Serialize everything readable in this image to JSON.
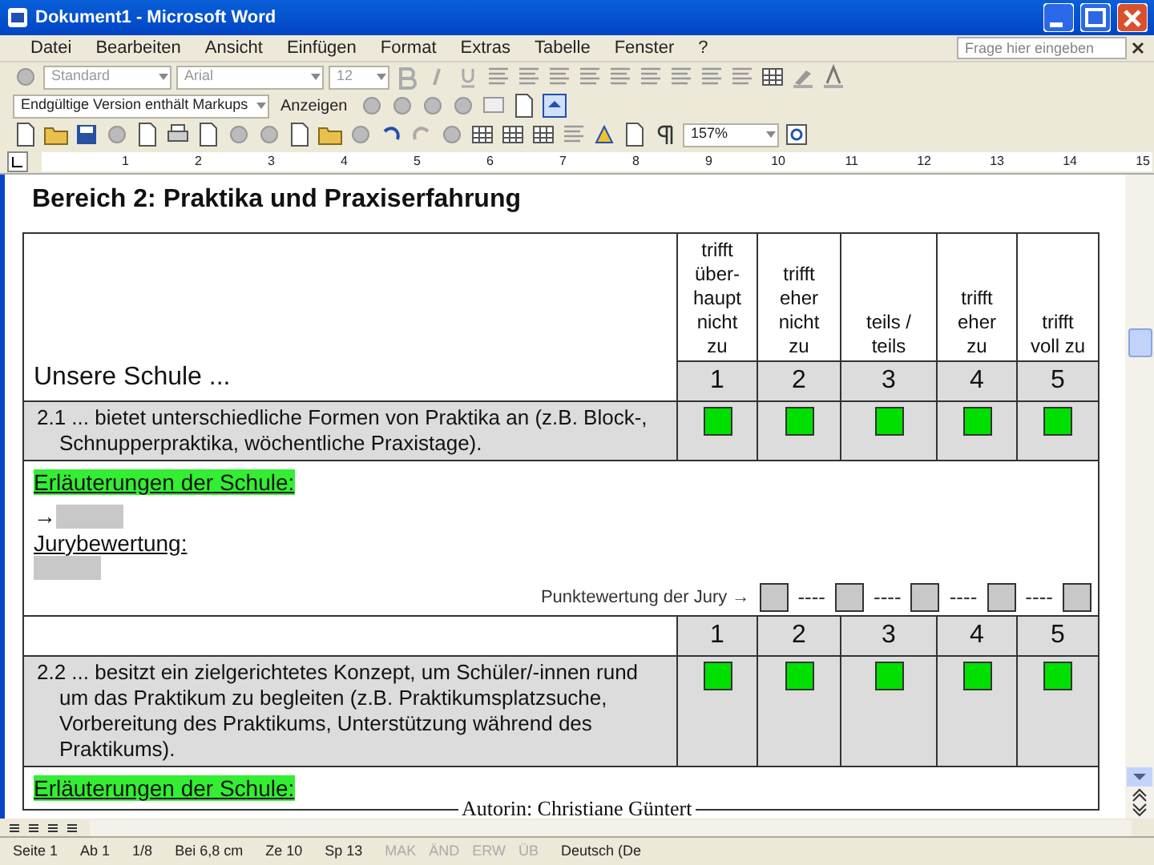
{
  "window": {
    "title": "Dokument1 - Microsoft Word"
  },
  "menu": [
    "Datei",
    "Bearbeiten",
    "Ansicht",
    "Einfügen",
    "Format",
    "Extras",
    "Tabelle",
    "Fenster",
    "?"
  ],
  "help_box": {
    "placeholder": "Frage hier eingeben"
  },
  "formatting": {
    "style": "Standard",
    "font": "Arial",
    "size": "12"
  },
  "reviewing": {
    "view": "Endgültige Version enthält Markups",
    "show": "Anzeigen"
  },
  "standard": {
    "zoom": "157%"
  },
  "ruler": [
    "1",
    "2",
    "3",
    "4",
    "5",
    "6",
    "7",
    "8",
    "9",
    "10",
    "11",
    "12",
    "13",
    "14",
    "15"
  ],
  "document": {
    "heading": "Bereich 2: Praktika und Praxiserfahrung",
    "table": {
      "intro": "Unsere Schule ...",
      "scale": [
        "trifft über-haupt nicht zu",
        "trifft eher nicht zu",
        "teils / teils",
        "trifft eher zu",
        "trifft voll zu"
      ],
      "items": [
        {
          "text": "2.1 ... bietet unterschiedliche Formen von Praktika an (z.B. Block-, Schnupperpraktika, wöchentliche Praxistage).",
          "numbers": [
            "1",
            "2",
            "3",
            "4",
            "5"
          ],
          "checkboxes": [
            {
              "checked": false
            },
            {
              "checked": false
            },
            {
              "checked": false
            },
            {
              "checked": false
            },
            {
              "checked": false
            }
          ],
          "explanation": {
            "label": "Erläuterungen der Schule:",
            "arrow": "→",
            "jury_label": "Jurybewertung:",
            "jury_line": "Punktewertung der Jury →",
            "separators": [
              "----",
              "----",
              "----",
              "----"
            ]
          }
        },
        {
          "text": "2.2 ... besitzt ein zielgerichtetes Konzept, um Schüler/-innen rund um das Praktikum zu begleiten (z.B. Praktikumsplatzsuche, Vorbereitung des Praktikums, Unterstützung während des Praktikums).",
          "numbers": [
            "1",
            "2",
            "3",
            "4",
            "5"
          ],
          "checkboxes": [
            {
              "checked": false
            },
            {
              "checked": false
            },
            {
              "checked": false
            },
            {
              "checked": false
            },
            {
              "checked": false
            }
          ],
          "explanation": {
            "label": "Erläuterungen der Schule:"
          }
        }
      ]
    },
    "footer": "Autorin: Christiane Güntert"
  },
  "status_bar": {
    "items": [
      "Seite 1",
      "Ab 1",
      "1/8",
      "Bei 6,8 cm",
      "Ze 10",
      "Sp 13"
    ],
    "modes": [
      {
        "label": "MAK",
        "disabled": true
      },
      {
        "label": "ÄND",
        "disabled": true
      },
      {
        "label": "ERW",
        "disabled": true
      },
      {
        "label": "ÜB",
        "disabled": true
      }
    ],
    "language": "Deutsch (De"
  }
}
